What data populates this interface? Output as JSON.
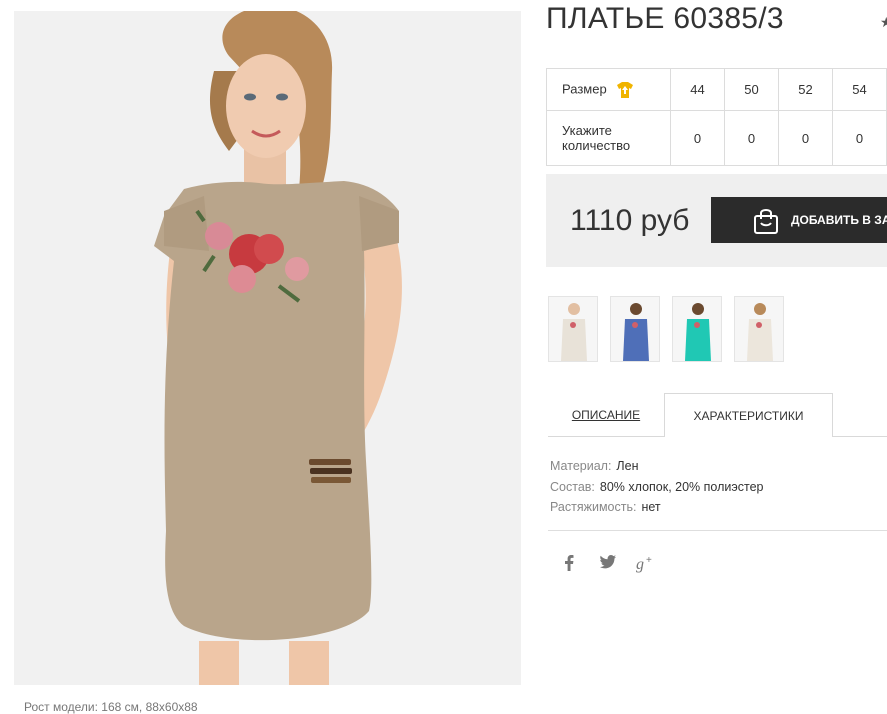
{
  "product": {
    "title": "ПЛАТЬЕ 60385/3",
    "photo_caption": "Рост модели: 168 см, 88х60х88"
  },
  "sizes": {
    "size_label": "Размер",
    "qty_label_line1": "Укажите",
    "qty_label_line2": "количество",
    "values": [
      "44",
      "50",
      "52",
      "54"
    ],
    "quantities": [
      "0",
      "0",
      "0",
      "0"
    ],
    "icon": "tshirt-up-icon"
  },
  "purchase": {
    "price": "1110 руб",
    "add_button_label": "ДОБАВИТЬ В ЗАКАЗ",
    "icon": "shopping-bag-icon"
  },
  "thumbnails": [
    {
      "name": "beige-front",
      "color": "#e8e2d8"
    },
    {
      "name": "blue-front",
      "color": "#4f6fb8"
    },
    {
      "name": "turquoise-front",
      "color": "#20c8b4"
    },
    {
      "name": "beige-front-2",
      "color": "#ece6dc"
    }
  ],
  "tabs": {
    "description": "ОПИСАНИЕ",
    "characteristics": "ХАРАКТЕРИСТИКИ",
    "active": "characteristics"
  },
  "specs": [
    {
      "label": "Материал:",
      "value": "Лен"
    },
    {
      "label": "Состав:",
      "value": "80% хлопок, 20% полиэстер"
    },
    {
      "label": "Растяжимость:",
      "value": "нет"
    }
  ],
  "social": [
    "facebook-icon",
    "twitter-icon",
    "google-plus-icon"
  ],
  "colors": {
    "accent_dark": "#2b2b2b",
    "price_bg": "#efefef",
    "size_icon": "#f0b400",
    "dress": "#b9a58b"
  }
}
